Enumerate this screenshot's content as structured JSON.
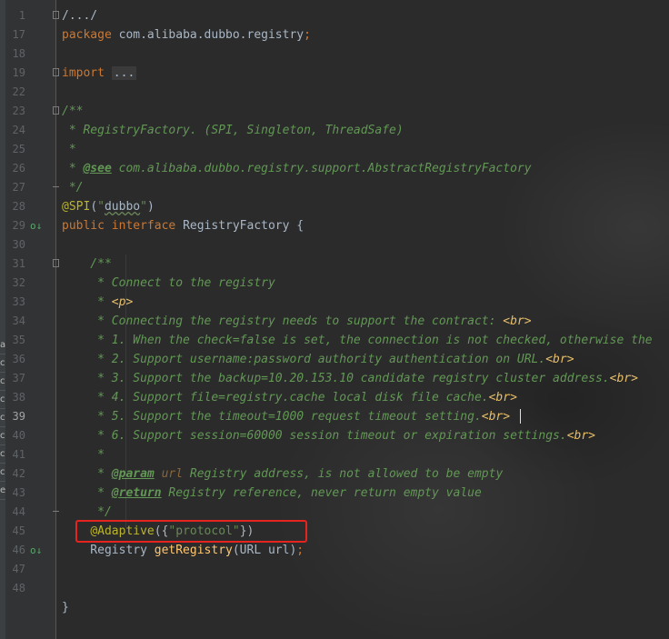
{
  "side_strip": {
    "visible_letters": [
      "a",
      "c",
      "c",
      "c",
      "c",
      "c",
      "c",
      "c",
      "es"
    ]
  },
  "lines": [
    {
      "n": "1",
      "tokens": [
        {
          "t": "/.../",
          "c": "plain"
        }
      ],
      "fold": "start"
    },
    {
      "n": "17",
      "tokens": [
        {
          "t": "package ",
          "c": "kw"
        },
        {
          "t": "com.alibaba.dubbo.registry",
          "c": "plain"
        },
        {
          "t": ";",
          "c": "kw"
        }
      ]
    },
    {
      "n": "18",
      "tokens": []
    },
    {
      "n": "19",
      "tokens": [
        {
          "t": "import ",
          "c": "kw"
        },
        {
          "t": "...",
          "c": "folded"
        }
      ],
      "fold": "start"
    },
    {
      "n": "22",
      "tokens": []
    },
    {
      "n": "23",
      "tokens": [
        {
          "t": "/**",
          "c": "cm"
        }
      ],
      "fold": "start"
    },
    {
      "n": "24",
      "tokens": [
        {
          "t": " * RegistryFactory. (SPI, Singleton, ThreadSafe)",
          "c": "cm"
        }
      ]
    },
    {
      "n": "25",
      "tokens": [
        {
          "t": " *",
          "c": "cm"
        }
      ]
    },
    {
      "n": "26",
      "tokens": [
        {
          "t": " * ",
          "c": "cm"
        },
        {
          "t": "@see",
          "c": "doctag"
        },
        {
          "t": " com.alibaba.dubbo.registry.support.AbstractRegistryFactory",
          "c": "cm"
        }
      ]
    },
    {
      "n": "27",
      "tokens": [
        {
          "t": " */",
          "c": "cm"
        }
      ],
      "fold": "end"
    },
    {
      "n": "28",
      "tokens": [
        {
          "t": "@SPI",
          "c": "ann"
        },
        {
          "t": "(",
          "c": "plain"
        },
        {
          "t": "\"",
          "c": "str"
        },
        {
          "t": "dubbo",
          "c": "sq"
        },
        {
          "t": "\"",
          "c": "str"
        },
        {
          "t": ")",
          "c": "plain"
        }
      ]
    },
    {
      "n": "29",
      "tokens": [
        {
          "t": "public interface ",
          "c": "kw"
        },
        {
          "t": "RegistryFactory {",
          "c": "plain"
        }
      ],
      "icon": "o↓"
    },
    {
      "n": "30",
      "tokens": []
    },
    {
      "n": "31",
      "tokens": [
        {
          "t": "    /**",
          "c": "cm"
        }
      ],
      "fold": "start"
    },
    {
      "n": "32",
      "tokens": [
        {
          "t": "     * Connect to the registry",
          "c": "cm"
        }
      ]
    },
    {
      "n": "33",
      "tokens": [
        {
          "t": "     * ",
          "c": "cm"
        },
        {
          "t": "<p>",
          "c": "tag"
        }
      ]
    },
    {
      "n": "34",
      "tokens": [
        {
          "t": "     * Connecting the registry needs to support the contract: ",
          "c": "cm"
        },
        {
          "t": "<br>",
          "c": "tag"
        }
      ]
    },
    {
      "n": "35",
      "tokens": [
        {
          "t": "     * 1. When the check=false is set, the connection is not checked, otherwise the",
          "c": "cm"
        }
      ]
    },
    {
      "n": "36",
      "tokens": [
        {
          "t": "     * 2. Support username:password authority authentication on URL.",
          "c": "cm"
        },
        {
          "t": "<br>",
          "c": "tag"
        }
      ]
    },
    {
      "n": "37",
      "tokens": [
        {
          "t": "     * 3. Support the backup=10.20.153.10 candidate registry cluster address.",
          "c": "cm"
        },
        {
          "t": "<br>",
          "c": "tag"
        }
      ]
    },
    {
      "n": "38",
      "tokens": [
        {
          "t": "     * 4. Support file=registry.cache local disk file cache.",
          "c": "cm"
        },
        {
          "t": "<br>",
          "c": "tag"
        }
      ]
    },
    {
      "n": "39",
      "tokens": [
        {
          "t": "     * 5. Support the timeout=1000 request timeout setting.",
          "c": "cm"
        },
        {
          "t": "<br>",
          "c": "tag"
        }
      ],
      "current": true
    },
    {
      "n": "40",
      "tokens": [
        {
          "t": "     * 6. Support session=60000 session timeout or expiration settings.",
          "c": "cm"
        },
        {
          "t": "<br>",
          "c": "tag"
        }
      ]
    },
    {
      "n": "41",
      "tokens": [
        {
          "t": "     *",
          "c": "cm"
        }
      ]
    },
    {
      "n": "42",
      "tokens": [
        {
          "t": "     * ",
          "c": "cm"
        },
        {
          "t": "@param",
          "c": "doctag"
        },
        {
          "t": " ",
          "c": "cm"
        },
        {
          "t": "url",
          "c": "param"
        },
        {
          "t": " Registry address, is not allowed to be empty",
          "c": "cm"
        }
      ]
    },
    {
      "n": "43",
      "tokens": [
        {
          "t": "     * ",
          "c": "cm"
        },
        {
          "t": "@return",
          "c": "doctag"
        },
        {
          "t": " Registry reference, never return empty value",
          "c": "cm"
        }
      ]
    },
    {
      "n": "44",
      "tokens": [
        {
          "t": "     */",
          "c": "cm"
        }
      ],
      "fold": "end"
    },
    {
      "n": "45",
      "tokens": [
        {
          "t": "    ",
          "c": "plain"
        },
        {
          "t": "@Adaptive",
          "c": "ann"
        },
        {
          "t": "({",
          "c": "plain"
        },
        {
          "t": "\"protocol\"",
          "c": "str"
        },
        {
          "t": "})",
          "c": "plain"
        }
      ]
    },
    {
      "n": "46",
      "tokens": [
        {
          "t": "    Registry ",
          "c": "plain"
        },
        {
          "t": "getRegistry",
          "c": "method"
        },
        {
          "t": "(URL url)",
          "c": "plain"
        },
        {
          "t": ";",
          "c": "kw"
        }
      ],
      "icon": "o↓"
    },
    {
      "n": "47",
      "tokens": []
    },
    {
      "n": "48",
      "tokens": []
    },
    {
      "n": "",
      "tokens": [
        {
          "t": "}",
          "c": "plain"
        }
      ]
    }
  ],
  "colors": {
    "highlight_box": "#e5241f",
    "background": "#2b2b2b"
  }
}
